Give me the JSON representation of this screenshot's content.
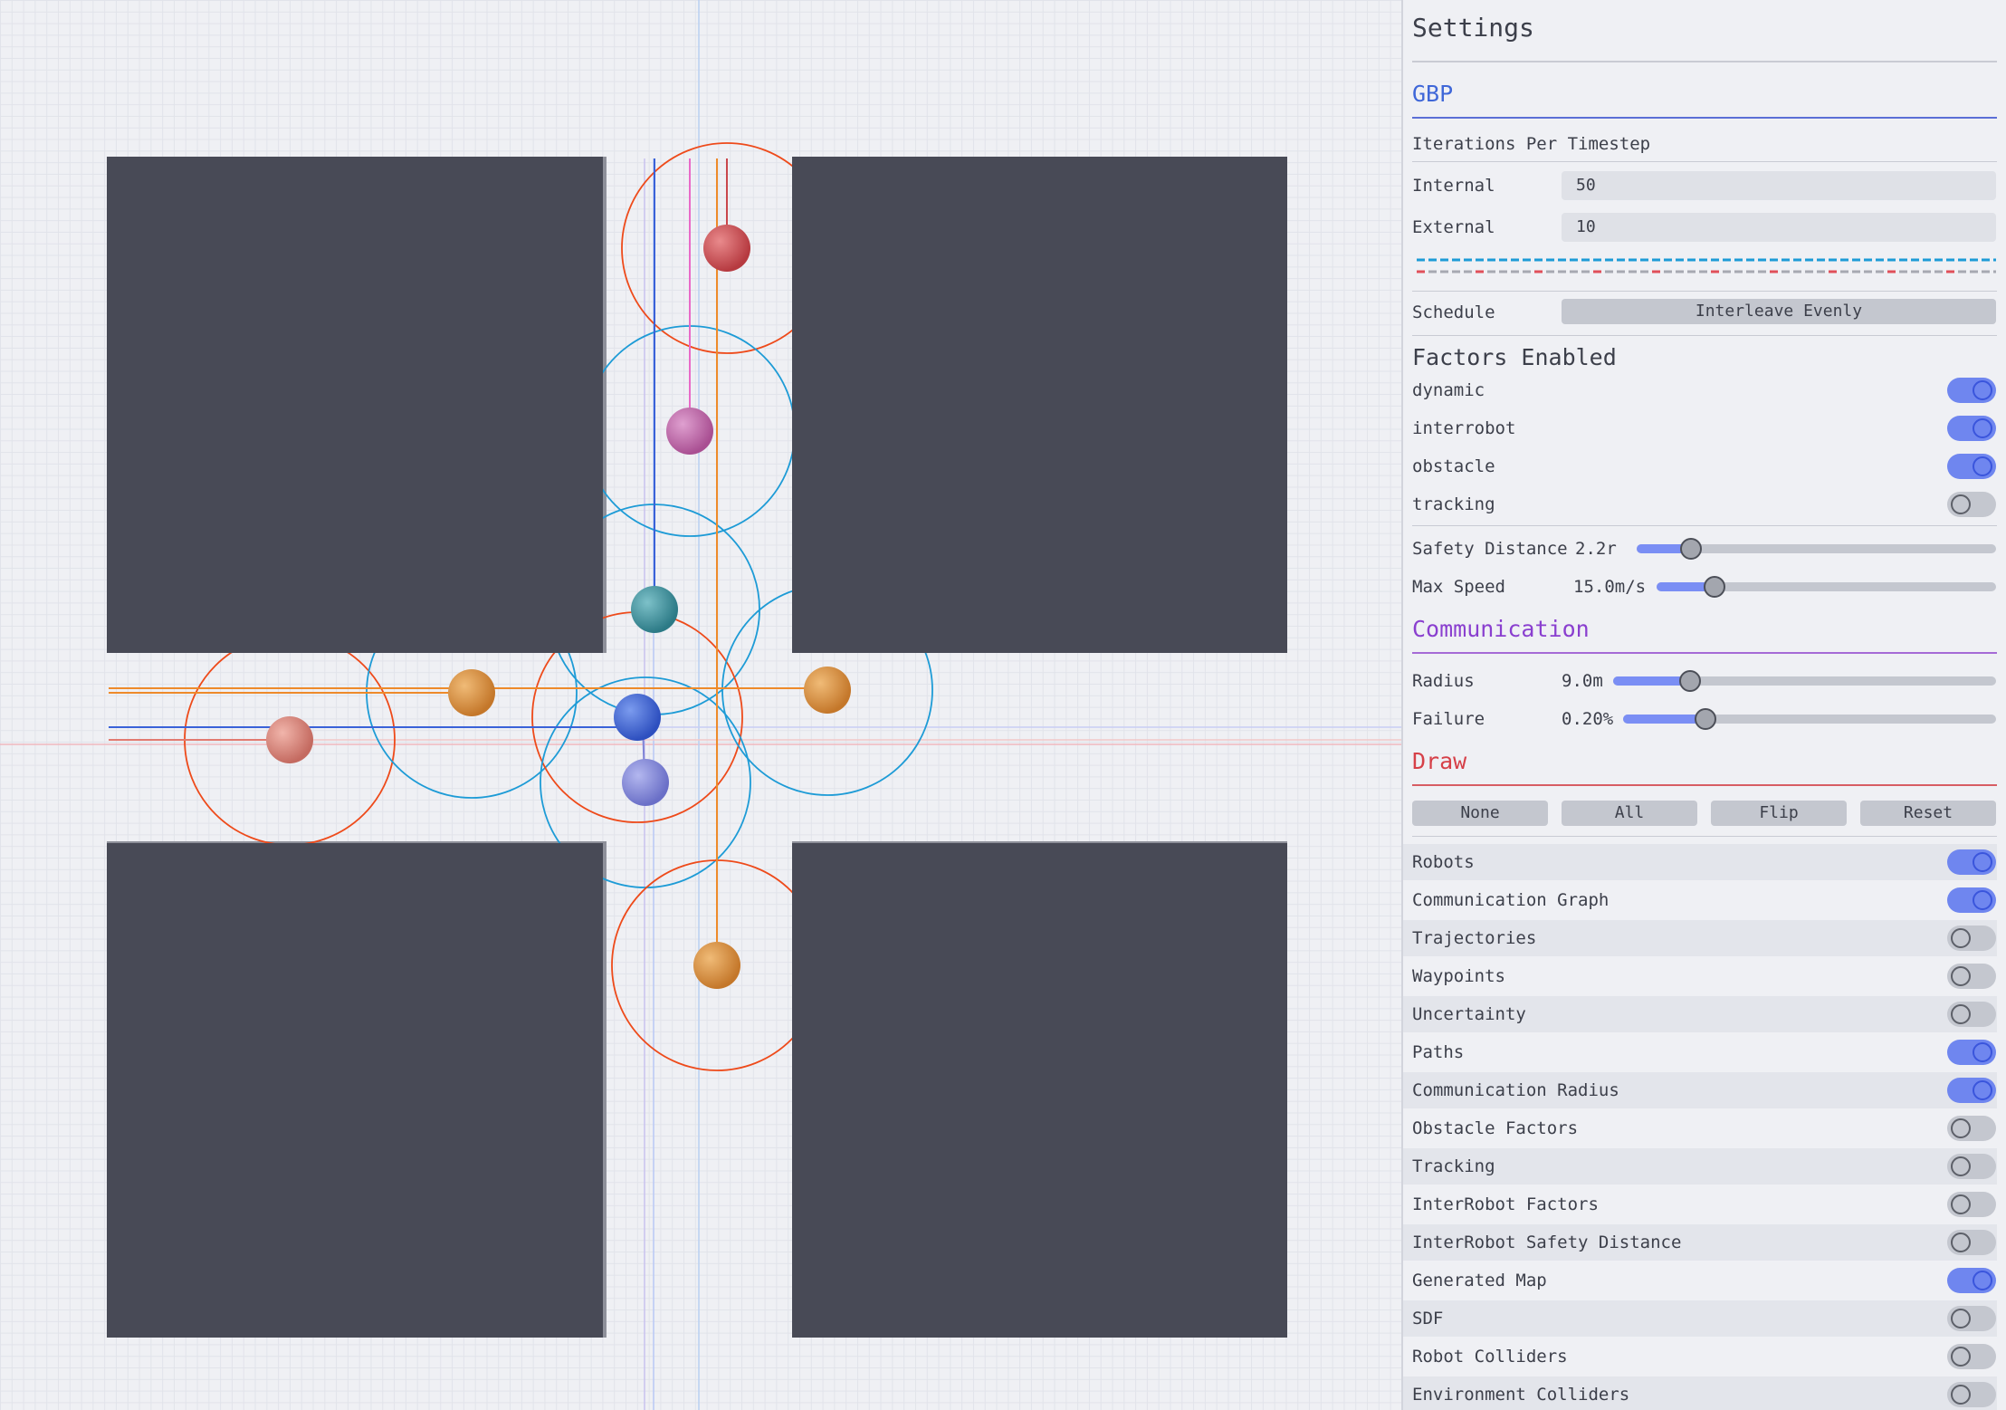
{
  "settings": {
    "title": "Settings",
    "gbp": {
      "header": "GBP",
      "iterations_label": "Iterations Per Timestep",
      "internal_label": "Internal",
      "internal_value": "50",
      "external_label": "External",
      "external_value": "10",
      "schedule_label": "Schedule",
      "schedule_value": "Interleave Evenly",
      "factors_header": "Factors Enabled",
      "factors": [
        {
          "label": "dynamic",
          "enabled": true
        },
        {
          "label": "interrobot",
          "enabled": true
        },
        {
          "label": "obstacle",
          "enabled": true
        },
        {
          "label": "tracking",
          "enabled": false
        }
      ],
      "safety_distance_label": "Safety Distance",
      "safety_distance_value": "2.2r",
      "safety_distance_fraction": 0.15,
      "max_speed_label": "Max Speed",
      "max_speed_value": "15.0m/s",
      "max_speed_fraction": 0.17
    },
    "communication": {
      "header": "Communication",
      "radius_label": "Radius",
      "radius_value": "9.0m",
      "radius_fraction": 0.2,
      "failure_label": "Failure",
      "failure_value": "0.20%",
      "failure_fraction": 0.22
    },
    "draw": {
      "header": "Draw",
      "buttons": [
        "None",
        "All",
        "Flip",
        "Reset"
      ],
      "items": [
        {
          "label": "Robots",
          "enabled": true
        },
        {
          "label": "Communication Graph",
          "enabled": true
        },
        {
          "label": "Trajectories",
          "enabled": false
        },
        {
          "label": "Waypoints",
          "enabled": false
        },
        {
          "label": "Uncertainty",
          "enabled": false
        },
        {
          "label": "Paths",
          "enabled": true
        },
        {
          "label": "Communication Radius",
          "enabled": true
        },
        {
          "label": "Obstacle Factors",
          "enabled": false
        },
        {
          "label": "Tracking",
          "enabled": false
        },
        {
          "label": "InterRobot Factors",
          "enabled": false
        },
        {
          "label": "InterRobot Safety Distance",
          "enabled": false
        },
        {
          "label": "Generated Map",
          "enabled": true
        },
        {
          "label": "SDF",
          "enabled": false
        },
        {
          "label": "Robot Colliders",
          "enabled": false
        },
        {
          "label": "Environment Colliders",
          "enabled": false
        }
      ]
    }
  },
  "colors": {
    "obstacle": "#484a56",
    "comm_radius_blue": "#1d9bd6",
    "comm_radius_red": "#ee4a1a",
    "toggle_on": "#6f86ef",
    "robot_red": "#c9474c",
    "robot_pink": "#c267a8",
    "robot_teal": "#3f97a3",
    "robot_orange": "#d98c35",
    "robot_blue": "#3a62d8",
    "robot_lavender": "#7f84d6",
    "robot_salmon": "#d88277"
  }
}
